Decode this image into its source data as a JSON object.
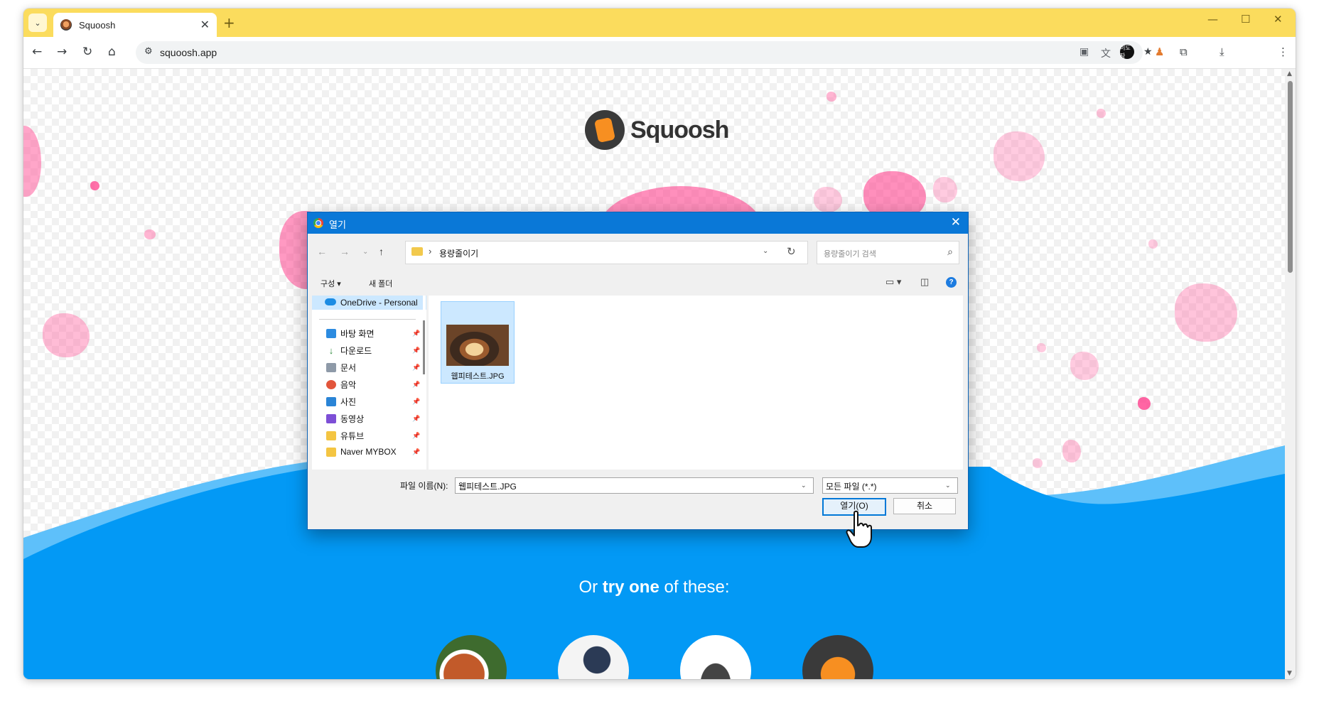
{
  "browser": {
    "tab_title": "Squoosh",
    "url": "squoosh.app",
    "profile_initials": "이도자",
    "icons": [
      "tab-search-icon",
      "close-icon",
      "new-tab-icon",
      "minimize-icon",
      "maximize-icon",
      "back-icon",
      "forward-icon",
      "reload-icon",
      "home-icon",
      "site-info-icon",
      "install-icon",
      "translate-icon",
      "eye-off-icon",
      "star-icon",
      "extension-icon",
      "puzzle-icon",
      "download-icon",
      "menu-icon"
    ],
    "colors": {
      "tabstrip": "#fbdc5d"
    }
  },
  "page": {
    "logo_text": "Squoosh",
    "or_try_prefix": "Or ",
    "or_try_bold1": "try",
    "or_try_mid": " ",
    "or_try_bold2": "one",
    "or_try_suffix": " of these:",
    "colors": {
      "wave": "#0399f5",
      "wave_light": "#5ec0fa",
      "blob": "#ff3385"
    }
  },
  "dialog": {
    "title": "열기",
    "path_folder": "용량줄이기",
    "search_placeholder": "용량줄이기 검색",
    "organize_label": "구성 ▾",
    "new_folder_label": "새 폴더",
    "nav_items": [
      {
        "label": "OneDrive - Personal",
        "icon": "cloud-icon"
      },
      {
        "label": "바탕 화면",
        "icon": "desktop-icon"
      },
      {
        "label": "다운로드",
        "icon": "download-icon"
      },
      {
        "label": "문서",
        "icon": "document-icon"
      },
      {
        "label": "음악",
        "icon": "music-icon"
      },
      {
        "label": "사진",
        "icon": "picture-icon"
      },
      {
        "label": "동영상",
        "icon": "video-icon"
      },
      {
        "label": "유튜브",
        "icon": "folder-icon"
      },
      {
        "label": "Naver MYBOX",
        "icon": "folder-icon"
      }
    ],
    "file": {
      "name": "웹피테스트.JPG"
    },
    "filename_label": "파일 이름(N):",
    "filename_value": "웹피테스트.JPG",
    "filetype_value": "모든 파일 (*.*)",
    "open_label": "열기(O)",
    "cancel_label": "취소"
  }
}
